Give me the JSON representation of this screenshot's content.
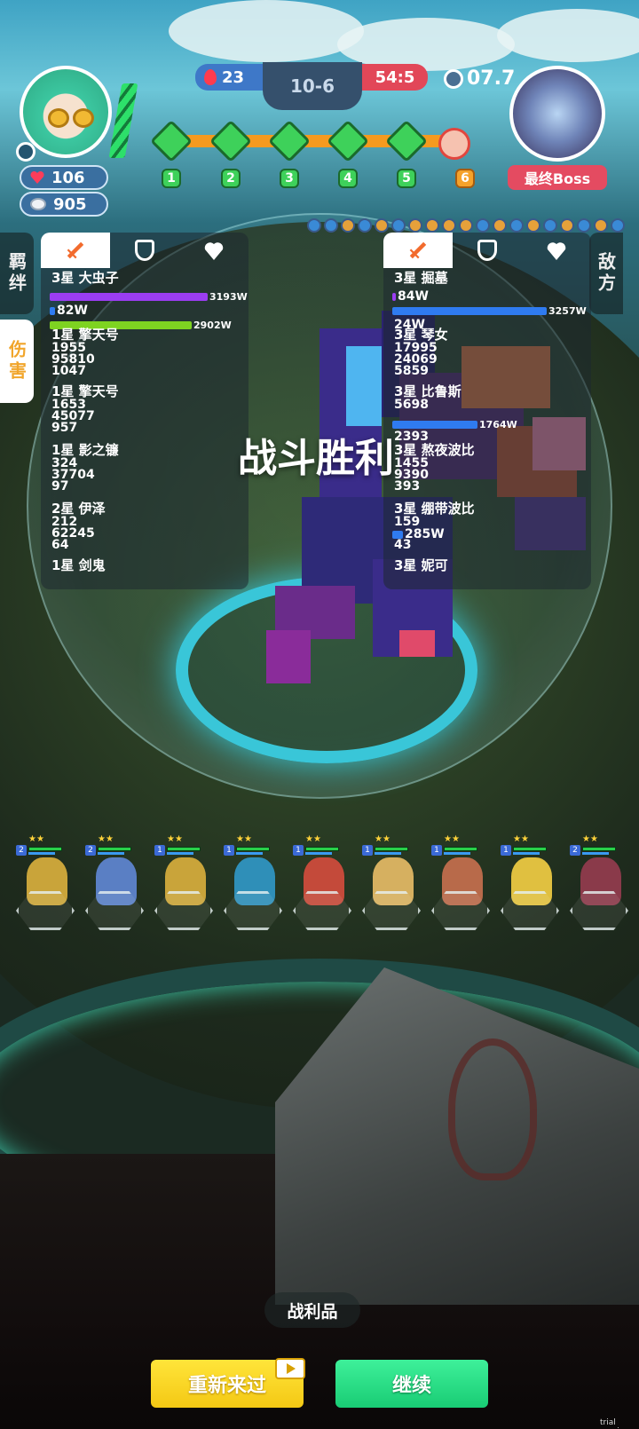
{
  "hud": {
    "hp": "106",
    "coins": "905",
    "round": "10-6",
    "ally_score": "23",
    "enemy_score": "54:5",
    "timer": "07.7",
    "boss_label": "最终Boss",
    "stages": [
      "1",
      "2",
      "3",
      "4",
      "5",
      "6"
    ]
  },
  "side_tabs": {
    "bond": "羁绊",
    "damage": "伤害",
    "enemy": "敌方"
  },
  "ally_panel": {
    "units": [
      {
        "name": "3星 大虫子",
        "bar1": "3193W",
        "bar2": "82W",
        "bar3": "2902W",
        "stats": []
      },
      {
        "name": "1星 擎天号",
        "stats": [
          "1955",
          "95810",
          "1047"
        ]
      },
      {
        "name": "1星 擎天号",
        "stats": [
          "1653",
          "45077",
          "957"
        ]
      },
      {
        "name": "1星 影之镰",
        "stats": [
          "324",
          "37704",
          "97"
        ]
      },
      {
        "name": "2星 伊泽",
        "stats": [
          "212",
          "62245",
          "64"
        ]
      },
      {
        "name": "1星 剑鬼",
        "stats": []
      }
    ]
  },
  "enemy_panel": {
    "units": [
      {
        "name": "3星 掘墓",
        "bar1": "84W",
        "bar2": "3257W",
        "bar3": "24W",
        "stats": []
      },
      {
        "name": "3星 琴女",
        "stats": [
          "17995",
          "24069",
          "5859"
        ]
      },
      {
        "name": "3星 比鲁斯",
        "stats": [
          "5698"
        ],
        "bar": "1764W",
        "extra": "2393"
      },
      {
        "name": "3星 熬夜波比",
        "stats": [
          "1455",
          "9390",
          "393"
        ]
      },
      {
        "name": "3星 绷带波比",
        "stats": [
          "159"
        ],
        "bar": "285W",
        "extra": "43"
      },
      {
        "name": "3星 妮可",
        "stats": []
      }
    ]
  },
  "victory_text": "战斗胜利",
  "heroes": [
    {
      "lvl": "2",
      "color": "#c9a43a"
    },
    {
      "lvl": "2",
      "color": "#5a7fc4"
    },
    {
      "lvl": "1",
      "color": "#c9a43a"
    },
    {
      "lvl": "1",
      "color": "#2f8fb8"
    },
    {
      "lvl": "1",
      "color": "#c44a3a"
    },
    {
      "lvl": "1",
      "color": "#d6b060"
    },
    {
      "lvl": "1",
      "color": "#b86a4a"
    },
    {
      "lvl": "1",
      "color": "#e0c040"
    },
    {
      "lvl": "2",
      "color": "#8a3a4a"
    }
  ],
  "bottom": {
    "loot_label": "战利品",
    "retry_label": "重新来过",
    "continue_label": "继续"
  },
  "watermark": "trial version"
}
